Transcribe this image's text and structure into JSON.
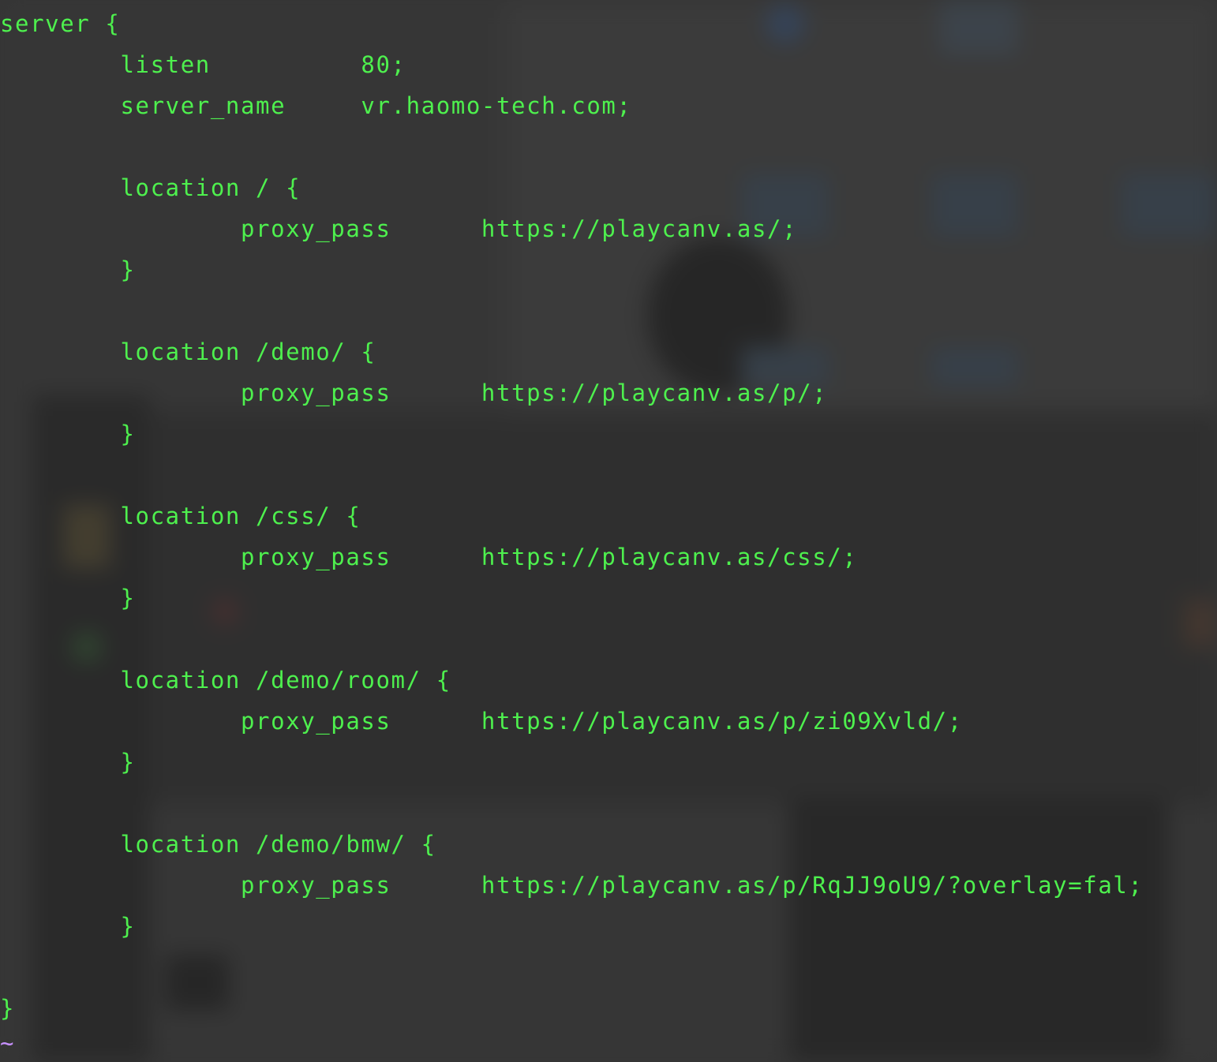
{
  "terminal": {
    "text_color": "#4ef04e",
    "tilde_color": "#c890ff",
    "lines": [
      "server {",
      "        listen          80;",
      "        server_name     vr.haomo-tech.com;",
      "",
      "        location / {",
      "                proxy_pass      https://playcanv.as/;",
      "        }",
      "",
      "        location /demo/ {",
      "                proxy_pass      https://playcanv.as/p/;",
      "        }",
      "",
      "        location /css/ {",
      "                proxy_pass      https://playcanv.as/css/;",
      "        }",
      "",
      "        location /demo/room/ {",
      "                proxy_pass      https://playcanv.as/p/zi09Xvld/;",
      "        }",
      "",
      "        location /demo/bmw/ {",
      "                proxy_pass      https://playcanv.as/p/RqJJ9oU9/?overlay=fal;",
      "        }",
      "",
      "}"
    ],
    "empty_line_marker": "~"
  }
}
